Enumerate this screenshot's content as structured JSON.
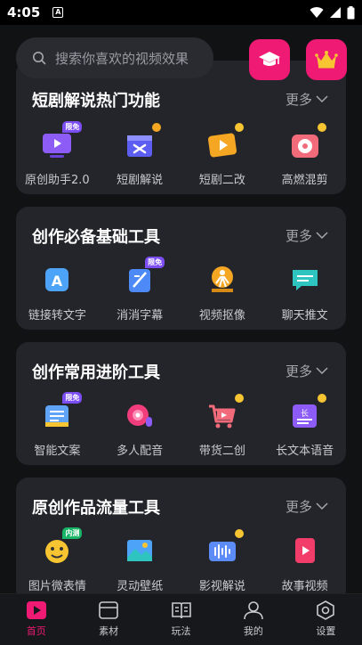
{
  "status": {
    "time": "4:05",
    "notif_letter": "A"
  },
  "search": {
    "placeholder": "搜索你喜欢的视频效果"
  },
  "colors": {
    "accent": "#ee1a73",
    "card_bg": "#24252b",
    "bg": "#111214"
  },
  "sections": [
    {
      "title": "短剧解说热门功能",
      "more": "更多",
      "tools": [
        {
          "label": "原创助手2.0",
          "icon": "tv-icon",
          "badge": "限免"
        },
        {
          "label": "短剧解说",
          "icon": "clapper-icon"
        },
        {
          "label": "短剧二改",
          "icon": "film-play-icon"
        },
        {
          "label": "高燃混剪",
          "icon": "music-disc-icon"
        }
      ]
    },
    {
      "title": "创作必备基础工具",
      "more": "更多",
      "tools": [
        {
          "label": "链接转文字",
          "icon": "letter-a-icon"
        },
        {
          "label": "消消字幕",
          "icon": "eraser-icon",
          "badge": "限免"
        },
        {
          "label": "视频抠像",
          "icon": "person-cutout-icon"
        },
        {
          "label": "聊天推文",
          "icon": "chat-icon"
        }
      ]
    },
    {
      "title": "创作常用进阶工具",
      "more": "更多",
      "tools": [
        {
          "label": "智能文案",
          "icon": "document-icon",
          "badge": "限免"
        },
        {
          "label": "多人配音",
          "icon": "voice-icon"
        },
        {
          "label": "带货二创",
          "icon": "cart-icon"
        },
        {
          "label": "长文本语音",
          "icon": "long-text-icon"
        }
      ]
    },
    {
      "title": "原创作品流量工具",
      "more": "更多",
      "tools": [
        {
          "label": "图片微表情",
          "icon": "emoji-image-icon",
          "badge": "内测",
          "badge_color": "green"
        },
        {
          "label": "灵动壁纸",
          "icon": "wallpaper-icon"
        },
        {
          "label": "影视解说",
          "icon": "movie-commentary-icon"
        },
        {
          "label": "故事视频",
          "icon": "story-video-icon"
        }
      ]
    }
  ],
  "tabbar": [
    {
      "label": "首页",
      "icon": "home-play-icon",
      "active": true
    },
    {
      "label": "素材",
      "icon": "folder-icon"
    },
    {
      "label": "玩法",
      "icon": "book-icon"
    },
    {
      "label": "我的",
      "icon": "user-icon"
    },
    {
      "label": "设置",
      "icon": "settings-icon"
    }
  ]
}
